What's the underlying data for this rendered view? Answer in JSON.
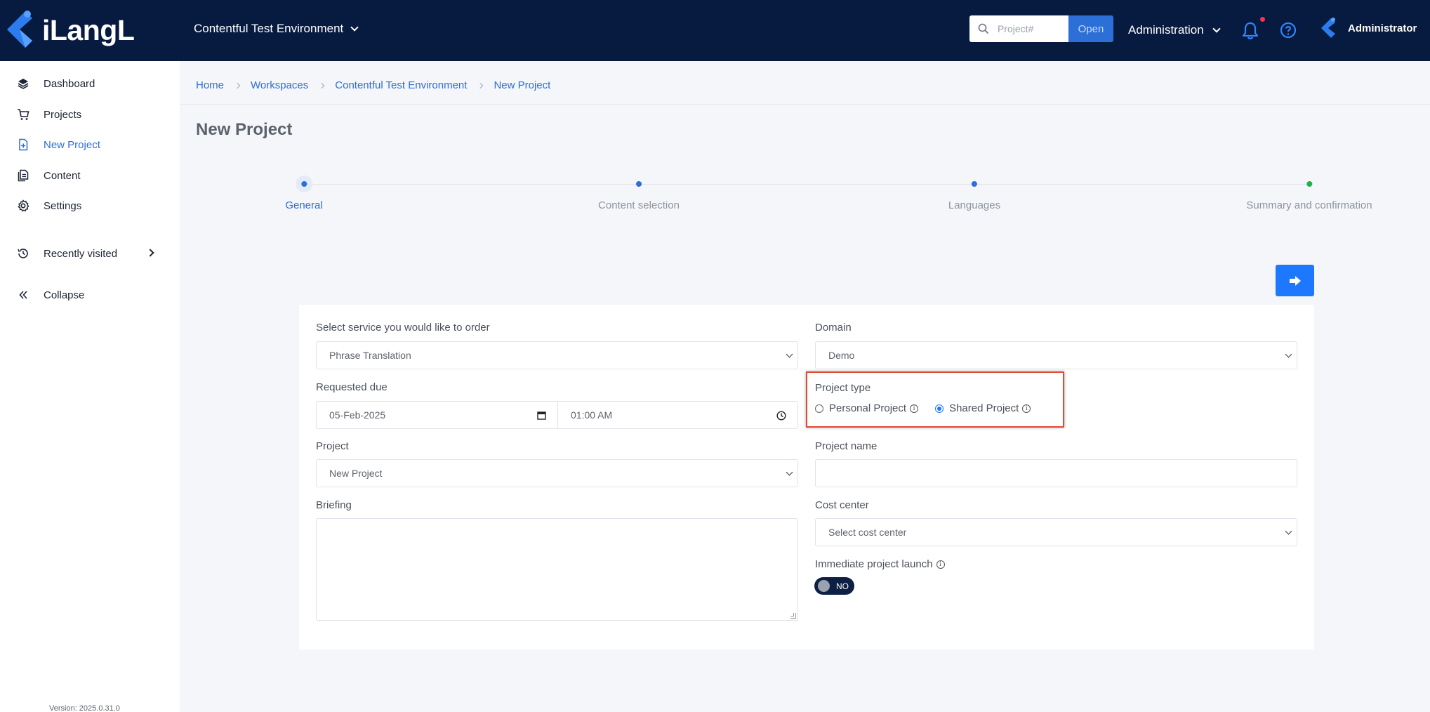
{
  "app": {
    "logo_text": "iLangL"
  },
  "header": {
    "environment": "Contentful Test Environment",
    "search_placeholder": "Project#",
    "open_label": "Open",
    "admin_menu": "Administration",
    "user_name": "Administrator"
  },
  "sidebar": {
    "items": [
      {
        "label": "Dashboard",
        "icon": "layers-icon"
      },
      {
        "label": "Projects",
        "icon": "cart-icon"
      },
      {
        "label": "New Project",
        "icon": "new-file-icon"
      },
      {
        "label": "Content",
        "icon": "documents-icon"
      },
      {
        "label": "Settings",
        "icon": "gear-icon"
      }
    ],
    "recently_visited": "Recently visited",
    "collapse": "Collapse",
    "version": "Version: 2025.0.31.0"
  },
  "breadcrumb": [
    "Home",
    "Workspaces",
    "Contentful Test Environment",
    "New Project"
  ],
  "page_title": "New Project",
  "steps": [
    "General",
    "Content selection",
    "Languages",
    "Summary and confirmation"
  ],
  "form": {
    "service_label": "Select service you would like to order",
    "service_value": "Phrase Translation",
    "domain_label": "Domain",
    "domain_value": "Demo",
    "due_label": "Requested due",
    "due_date": "05-Feb-2025",
    "due_time": "01:00 AM",
    "project_type_label": "Project type",
    "personal_project": "Personal Project",
    "shared_project": "Shared Project",
    "project_label": "Project",
    "project_value": "New Project",
    "project_name_label": "Project name",
    "project_name_value": "",
    "briefing_label": "Briefing",
    "cost_center_label": "Cost center",
    "cost_center_value": "Select cost center",
    "immediate_launch_label": "Immediate project launch",
    "immediate_launch_value": "NO"
  },
  "colors": {
    "header_bg": "#071a3f",
    "accent": "#2c6fd6",
    "step_done": "#21b24a",
    "highlight": "#e24a33"
  }
}
